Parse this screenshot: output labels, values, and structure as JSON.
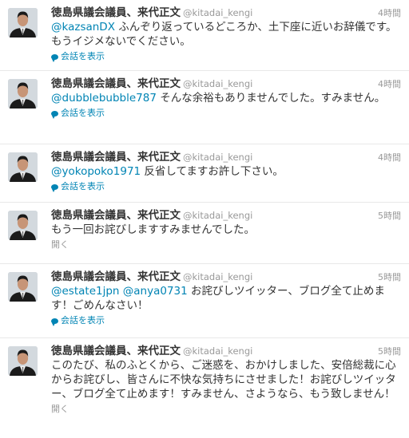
{
  "tweets": [
    {
      "name": "徳島県議会議員、来代正文",
      "handle": "@kitadai_kengi",
      "time": "4時間",
      "mentions": [
        "@kazsanDX"
      ],
      "body": " ふんぞり返っているどころか、土下座に近いお辞儀です。もうイジメないでください。",
      "action": "会話を表示"
    },
    {
      "name": "徳島県議会議員、来代正文",
      "handle": "@kitadai_kengi",
      "time": "4時間",
      "mentions": [
        "@dubblebubble787"
      ],
      "body": " そんな余裕もありませんでした。すみません。",
      "action": "会話を表示"
    },
    {
      "name": "徳島県議会議員、来代正文",
      "handle": "@kitadai_kengi",
      "time": "4時間",
      "mentions": [
        "@yokopoko1971"
      ],
      "body": " 反省してますお許し下さい。",
      "action": "会話を表示"
    },
    {
      "name": "徳島県議会議員、来代正文",
      "handle": "@kitadai_kengi",
      "time": "5時間",
      "mentions": [],
      "body": "もう一回お詫びしますすみませんでした。",
      "action": "開く"
    },
    {
      "name": "徳島県議会議員、来代正文",
      "handle": "@kitadai_kengi",
      "time": "5時間",
      "mentions": [
        "@estate1jpn",
        "@anya0731"
      ],
      "body": " お詫びしツイッター、ブログ全て止めます！ごめんなさい！",
      "action": "会話を表示"
    },
    {
      "name": "徳島県議会議員、来代正文",
      "handle": "@kitadai_kengi",
      "time": "5時間",
      "mentions": [],
      "body": "このたび、私のふとくから、ご迷惑を、おかけしました、安倍総裁に心からお詫びし、皆さんに不快な気持ちにさせました！お詫びしツイッター、ブログ全て止めます！すみません、さようなら、もう致しません！",
      "action": "開く"
    }
  ]
}
